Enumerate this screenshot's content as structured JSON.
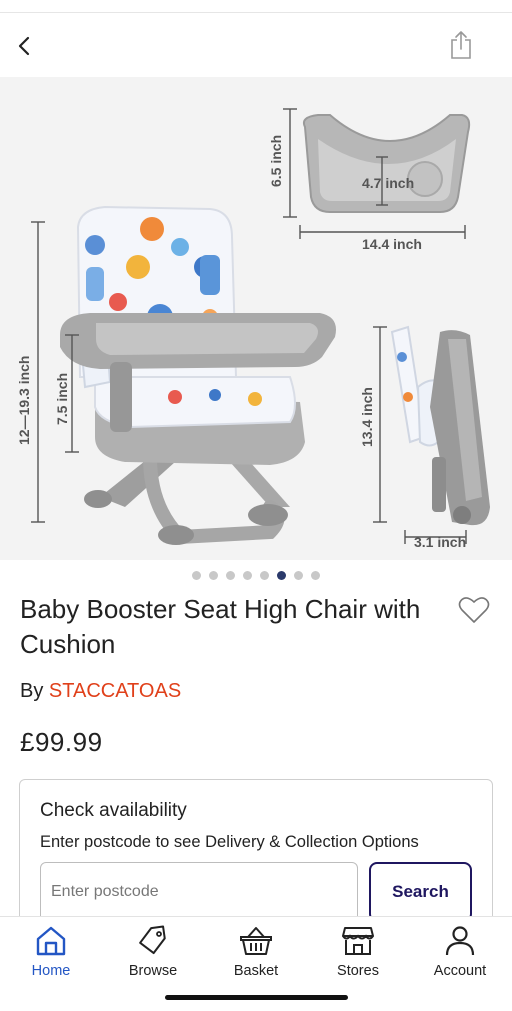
{
  "product": {
    "title": "Baby Booster Seat High Chair with Cushion",
    "by_label": "By",
    "brand": "STACCATOAS",
    "price": "£99.99"
  },
  "gallery": {
    "dimensions": {
      "tray_depth": "6.5 inch",
      "tray_inner": "4.7 inch",
      "tray_width": "14.4 inch",
      "seat_height": "12—19.3 inch",
      "back_height": "7.5 inch",
      "folded_height": "13.4 inch",
      "folded_depth": "3.1 inch"
    },
    "total_images": 8,
    "active_image": 6
  },
  "availability": {
    "title": "Check availability",
    "subtitle": "Enter postcode to see Delivery & Collection Options",
    "postcode_placeholder": "Enter postcode",
    "postcode_value": "",
    "search_label": "Search"
  },
  "nav": {
    "items": [
      {
        "label": "Home",
        "icon": "home-icon",
        "active": true
      },
      {
        "label": "Browse",
        "icon": "tag-icon",
        "active": false
      },
      {
        "label": "Basket",
        "icon": "basket-icon",
        "active": false
      },
      {
        "label": "Stores",
        "icon": "store-icon",
        "active": false
      },
      {
        "label": "Account",
        "icon": "account-icon",
        "active": false
      }
    ]
  },
  "colors": {
    "brand": "#e0401a",
    "accent": "#1f1760",
    "nav_active": "#2356c4",
    "dot_active": "#2b3a6b"
  }
}
